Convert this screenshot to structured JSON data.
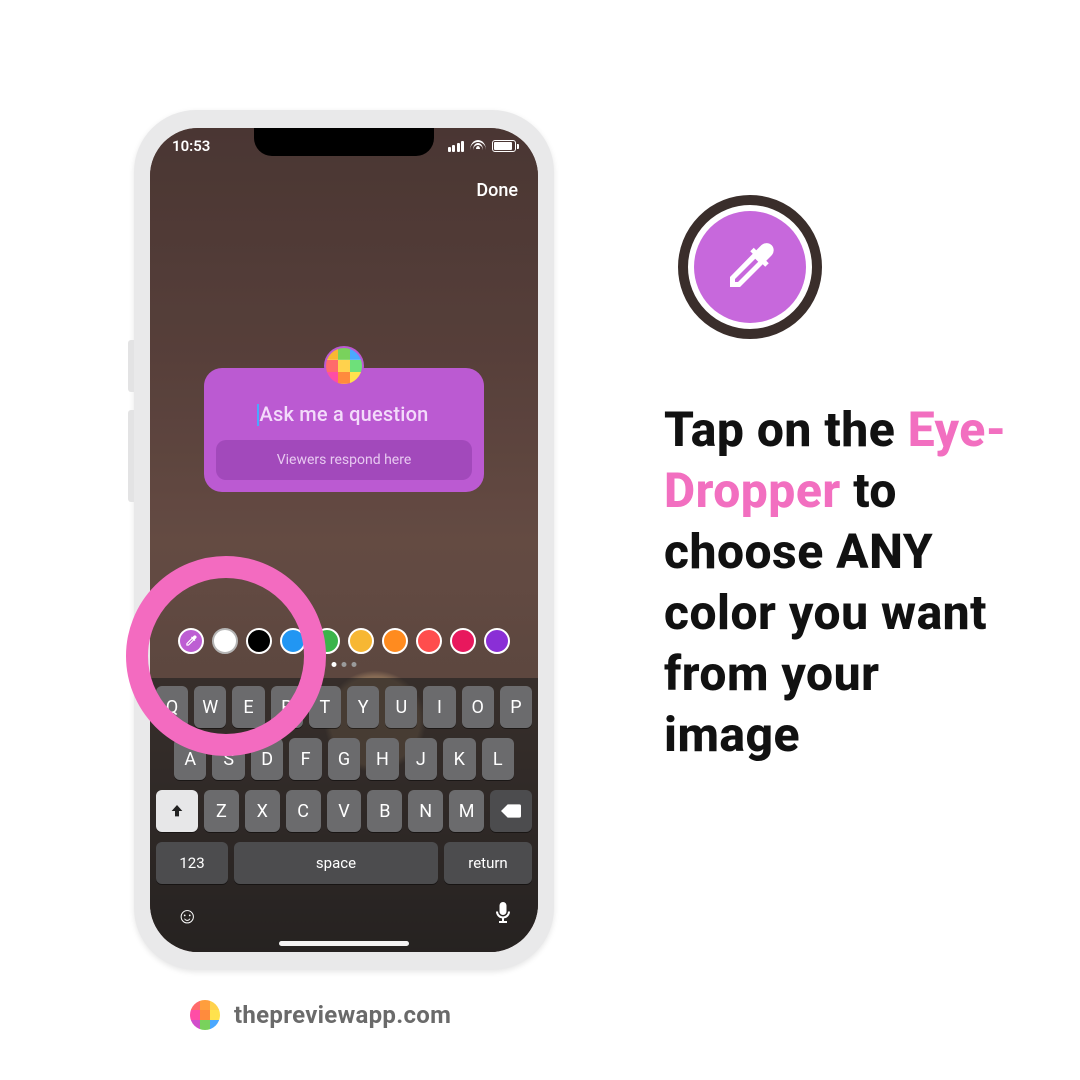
{
  "statusbar": {
    "time": "10:53"
  },
  "story": {
    "done_label": "Done",
    "question_placeholder": "Ask me a question",
    "respond_label": "Viewers respond here",
    "colors": [
      "#bd5ed3",
      "#ffffff",
      "#000000",
      "#2196f3",
      "#3bb44a",
      "#f7b733",
      "#ff8b1f",
      "#ff4d4d",
      "#e8185d",
      "#8a2fd6"
    ]
  },
  "keyboard": {
    "row1": [
      "Q",
      "W",
      "E",
      "R",
      "T",
      "Y",
      "U",
      "I",
      "O",
      "P"
    ],
    "row2": [
      "A",
      "S",
      "D",
      "F",
      "G",
      "H",
      "J",
      "K",
      "L"
    ],
    "row3": [
      "Z",
      "X",
      "C",
      "V",
      "B",
      "N",
      "M"
    ],
    "num": "123",
    "space": "space",
    "return": "return"
  },
  "instruction": {
    "pre": "Tap on the ",
    "accent": "Eye-Dropper",
    "post": " to choose ANY color you want from your image"
  },
  "watermark": "thepreviewapp.com"
}
